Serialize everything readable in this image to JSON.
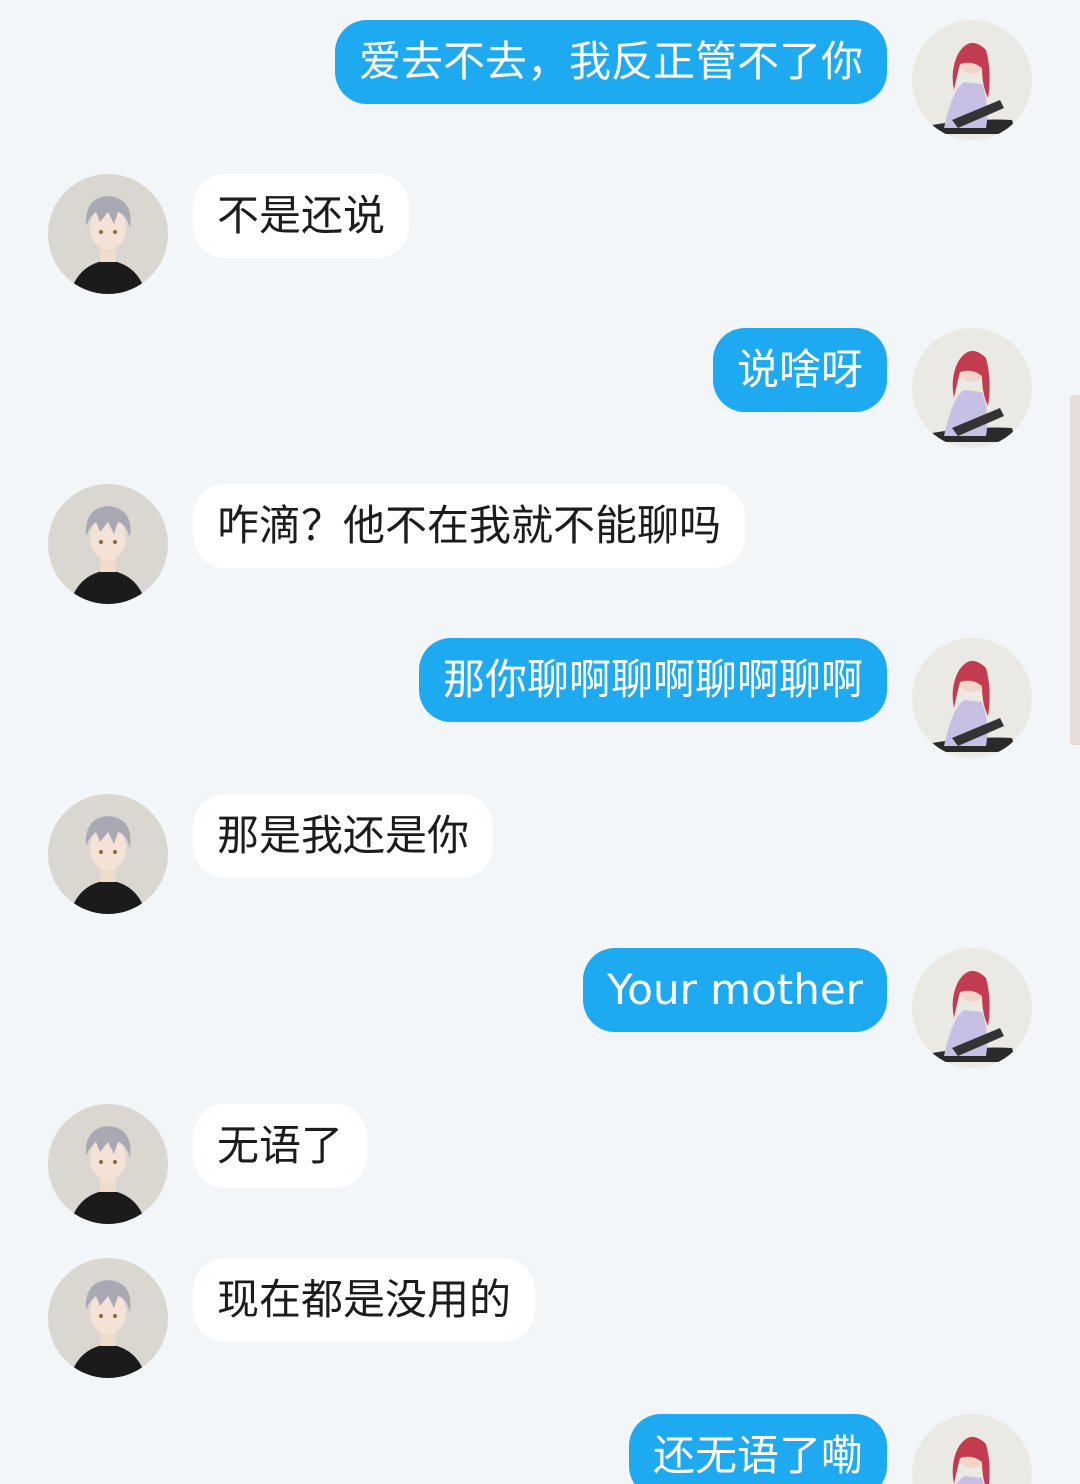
{
  "messages": [
    {
      "side": "outgoing",
      "text": "爱去不去，我反正管不了你"
    },
    {
      "side": "incoming",
      "text": "不是还说"
    },
    {
      "side": "outgoing",
      "text": "说啥呀"
    },
    {
      "side": "incoming",
      "text": "咋滴？他不在我就不能聊吗"
    },
    {
      "side": "outgoing",
      "text": "那你聊啊聊啊聊啊聊啊"
    },
    {
      "side": "incoming",
      "text": "那是我还是你"
    },
    {
      "side": "outgoing",
      "text": "Your mother"
    },
    {
      "side": "incoming",
      "text": "无语了"
    },
    {
      "side": "incoming",
      "text": "现在都是没用的"
    },
    {
      "side": "outgoing",
      "text": "还无语了嘞"
    }
  ],
  "colors": {
    "background": "#f3f6f8",
    "outgoing_bubble": "#1eaaf1",
    "incoming_bubble": "#ffffff"
  },
  "avatars": {
    "incoming": "silver-haired-boy-avatar",
    "outgoing": "red-haired-girl-avatar"
  }
}
